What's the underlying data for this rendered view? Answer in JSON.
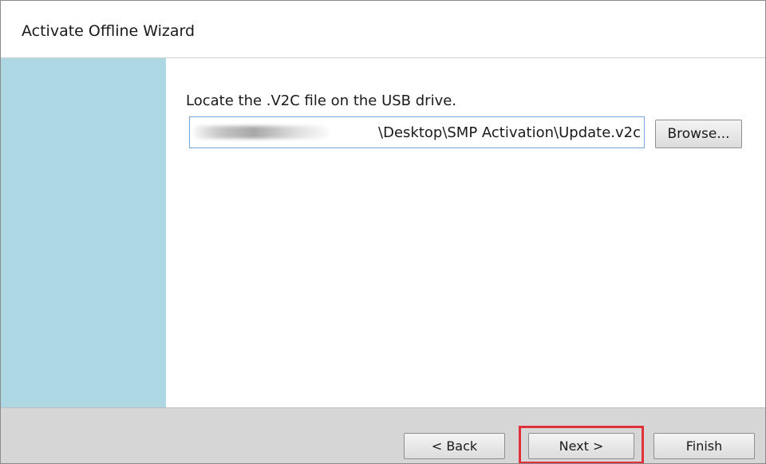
{
  "window": {
    "title": "Activate Offline Wizard"
  },
  "main": {
    "instruction": "Locate the .V2C file on the USB drive.",
    "file_path": {
      "visible_value": "\\Desktop\\SMP Activation\\Update.v2c",
      "obscured_prefix": true
    },
    "browse_label": "Browse..."
  },
  "footer": {
    "back_label": "< Back",
    "next_label": "Next >",
    "finish_label": "Finish",
    "highlighted_button": "Next >"
  },
  "colors": {
    "side_panel": "#add8e3",
    "footer": "#d6d6d6",
    "highlight": "#e0303a",
    "input_border": "#7aa7d6"
  }
}
